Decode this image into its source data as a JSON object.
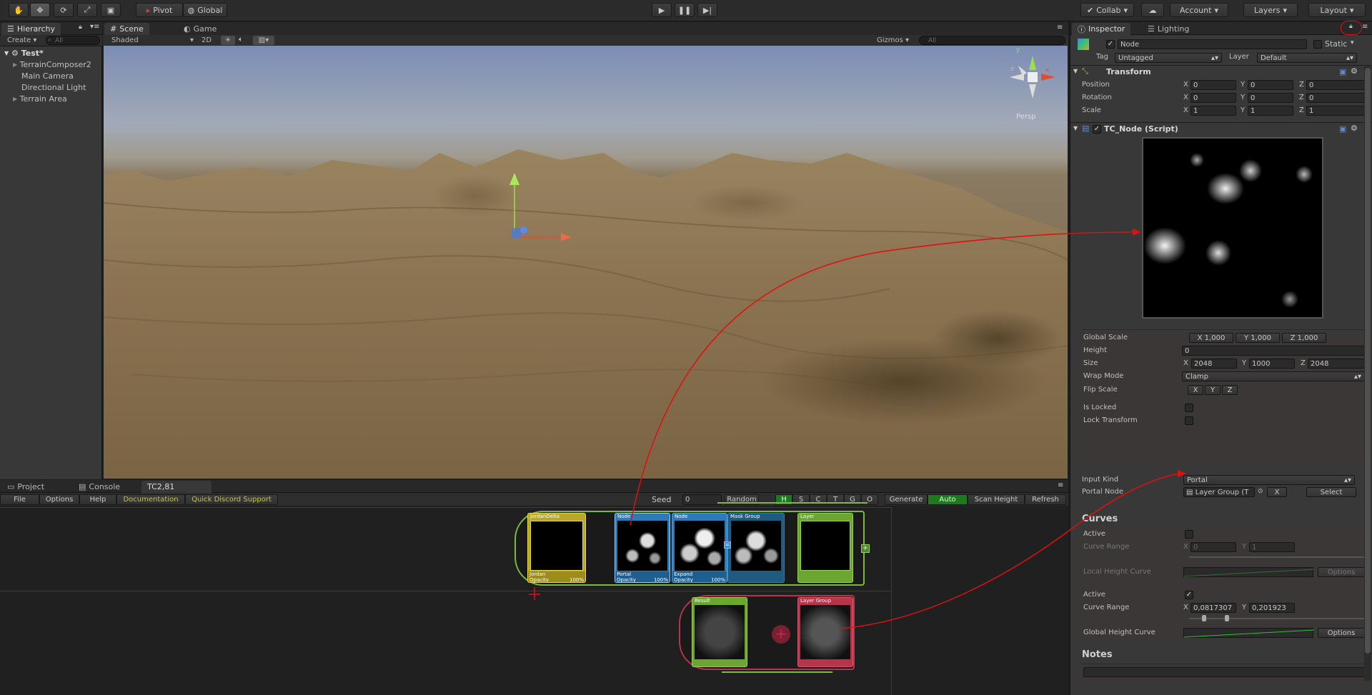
{
  "toolbar": {
    "pivot": "Pivot",
    "global": "Global",
    "collab": "Collab",
    "account": "Account",
    "layers": "Layers",
    "layout": "Layout"
  },
  "hierarchy": {
    "tab": "Hierarchy",
    "create": "Create",
    "search_placeholder": "All",
    "scene_name": "Test*",
    "items": [
      "TerrainComposer2",
      "Main Camera",
      "Directional Light",
      "Terrain Area"
    ]
  },
  "scene_view": {
    "tabs": [
      "Scene",
      "Game"
    ],
    "shading_mode": "Shaded",
    "mode_2d": "2D",
    "gizmos": "Gizmos",
    "search_placeholder": "All",
    "gizmo_label": "Persp",
    "gizmo_axes": [
      "y",
      "x",
      "z"
    ]
  },
  "bottom_panel": {
    "tabs": [
      "Project",
      "Console",
      "TC2,81"
    ],
    "menu": [
      "File",
      "Options",
      "Help",
      "Documentation",
      "Quick Discord Support"
    ],
    "seed_label": "Seed",
    "seed_value": "0",
    "random": "Random",
    "channels": [
      "H",
      "S",
      "C",
      "T",
      "G",
      "O"
    ],
    "generate": "Generate",
    "auto": "Auto",
    "scan_height": "Scan Height",
    "refresh": "Refresh"
  },
  "nodes": {
    "top_row": [
      {
        "title": "JordanDelta",
        "caption": "Jordan",
        "opacity": "Opacity",
        "percent": "100%",
        "color": "#d8c63a"
      },
      {
        "title": "Node",
        "caption": "Portal",
        "opacity": "Opacity",
        "percent": "100%",
        "color": "#3b8fc9"
      },
      {
        "title": "Node",
        "caption": "Expand",
        "opacity": "Opacity",
        "percent": "100%",
        "color": "#3b8fc9"
      },
      {
        "title": "Mask Group",
        "caption": "",
        "opacity": "",
        "percent": "",
        "color": "#2f6f9a"
      },
      {
        "title": "Layer",
        "caption": "",
        "opacity": "",
        "percent": "",
        "color": "#7dba3c"
      }
    ],
    "bottom_row": [
      {
        "title": "Result",
        "color": "#7dba3c"
      },
      {
        "title": "Layer Group",
        "color": "#b8344a"
      }
    ]
  },
  "inspector": {
    "tabs": [
      "Inspector",
      "Lighting"
    ],
    "object_name": "Node",
    "static_label": "Static",
    "tag_label": "Tag",
    "tag_value": "Untagged",
    "layer_label": "Layer",
    "layer_value": "Default",
    "transform": {
      "title": "Transform",
      "rows": [
        {
          "label": "Position",
          "x": "0",
          "y": "0",
          "z": "0"
        },
        {
          "label": "Rotation",
          "x": "0",
          "y": "0",
          "z": "0"
        },
        {
          "label": "Scale",
          "x": "1",
          "y": "1",
          "z": "1"
        }
      ]
    },
    "script": {
      "title": "TC_Node (Script)",
      "global_scale_label": "Global Scale",
      "global_scale": [
        "X 1,000",
        "Y 1,000",
        "Z 1,000"
      ],
      "height_label": "Height",
      "height_value": "0",
      "size_label": "Size",
      "size": {
        "x": "2048",
        "y": "1000",
        "z": "2048"
      },
      "wrap_mode_label": "Wrap Mode",
      "wrap_mode_value": "Clamp",
      "flip_scale_label": "Flip Scale",
      "flip_scale": [
        "X",
        "Y",
        "Z"
      ],
      "is_locked_label": "Is Locked",
      "lock_transform_label": "Lock Transform",
      "input_kind_label": "Input Kind",
      "input_kind_value": "Portal",
      "portal_node_label": "Portal Node",
      "portal_node_value": "Layer Group (T",
      "portal_clear": "X",
      "portal_select": "Select"
    },
    "curves": {
      "title": "Curves",
      "active_label": "Active",
      "curve_range_label": "Curve Range",
      "curve_range_disabled": {
        "x": "0",
        "y": "1"
      },
      "local_height_curve_label": "Local Height Curve",
      "options": "Options",
      "active2_label": "Active",
      "curve_range2": {
        "x": "0,0817307",
        "y": "0,201923"
      },
      "global_height_curve_label": "Global Height Curve"
    },
    "notes_title": "Notes"
  },
  "colors": {
    "annotation_red": "#e01010",
    "accent_green": "#1f7a1f",
    "doc_yellow": "#c9c23a"
  }
}
